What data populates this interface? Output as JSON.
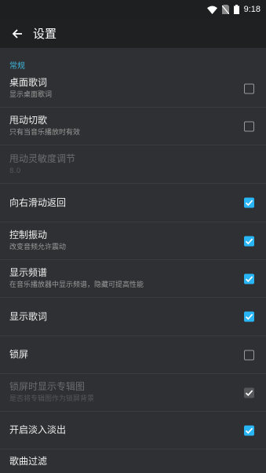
{
  "status": {
    "time": "9:18"
  },
  "toolbar": {
    "title": "设置"
  },
  "section": {
    "label": "常规"
  },
  "rows": [
    {
      "title": "桌面歌词",
      "subtitle": "显示桌面歌词",
      "checked": false
    },
    {
      "title": "甩动切歌",
      "subtitle": "只有当音乐播放时有效",
      "checked": false
    },
    {
      "title": "甩动灵敏度调节",
      "subtitle": "8.0",
      "disabled": true
    },
    {
      "title": "向右滑动返回",
      "checked": true
    },
    {
      "title": "控制振动",
      "subtitle": "改变音频允许震动",
      "checked": true
    },
    {
      "title": "显示频谱",
      "subtitle": "在音乐播放器中显示频谱，隐藏可提高性能",
      "checked": true
    },
    {
      "title": "显示歌词",
      "checked": true
    },
    {
      "title": "锁屏",
      "checked": false
    },
    {
      "title": "锁屏时显示专辑图",
      "subtitle": "是否将专辑图作为锁屏背景",
      "checked": true,
      "disabled": true
    },
    {
      "title": "开启淡入淡出",
      "checked": true
    },
    {
      "title": "歌曲过滤"
    }
  ]
}
